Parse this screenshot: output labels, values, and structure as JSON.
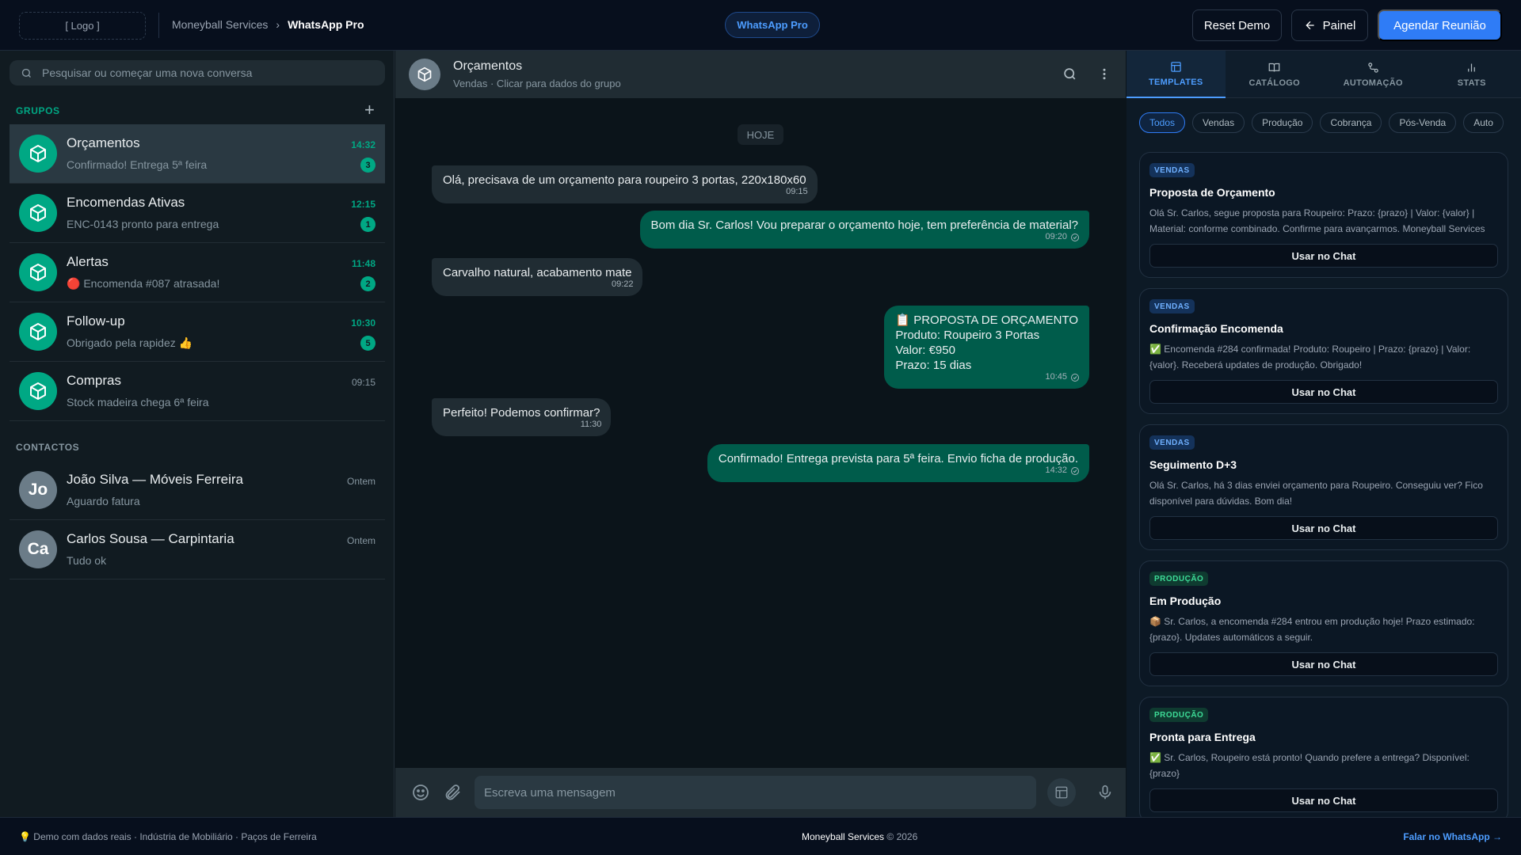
{
  "topbar": {
    "logo": "[ Logo ]",
    "breadcrumb_parent": "Moneyball Services",
    "breadcrumb_sep": "›",
    "breadcrumb_current": "WhatsApp Pro",
    "center_pill": "WhatsApp Pro",
    "reset_label": "Reset Demo",
    "panel_label": "Painel",
    "agendar_label": "Agendar Reunião"
  },
  "sidebar": {
    "search_placeholder": "Pesquisar ou começar uma nova conversa",
    "groups_header": "GRUPOS",
    "contacts_header": "CONTACTOS",
    "groups": [
      {
        "name": "Orçamentos",
        "preview": "Confirmado! Entrega 5ª feira",
        "time": "14:32",
        "badge": "3"
      },
      {
        "name": "Encomendas Ativas",
        "preview": "ENC-0143 pronto para entrega",
        "time": "12:15",
        "badge": "1"
      },
      {
        "name": "Alertas",
        "preview": "🔴 Encomenda #087 atrasada!",
        "time": "11:48",
        "badge": "2"
      },
      {
        "name": "Follow-up",
        "preview": "Obrigado pela rapidez 👍",
        "time": "10:30",
        "badge": "5"
      },
      {
        "name": "Compras",
        "preview": "Stock madeira chega 6ª feira",
        "time": "09:15",
        "badge": ""
      }
    ],
    "contacts": [
      {
        "initials": "Jo",
        "name": "João Silva — Móveis Ferreira",
        "preview": "Aguardo fatura",
        "time": "Ontem"
      },
      {
        "initials": "Ca",
        "name": "Carlos Sousa — Carpintaria",
        "preview": "Tudo ok",
        "time": "Ontem"
      }
    ]
  },
  "chat": {
    "title": "Orçamentos",
    "subtitle": "Vendas · Clicar para dados do grupo",
    "day_label": "HOJE",
    "messages": [
      {
        "dir": "in",
        "text": "Olá, precisava de um orçamento para roupeiro 3 portas, 220x180x60",
        "time": "09:15"
      },
      {
        "dir": "out",
        "text": "Bom dia Sr. Carlos! Vou preparar o orçamento hoje, tem preferência de material?",
        "time": "09:20"
      },
      {
        "dir": "in",
        "text": "Carvalho natural, acabamento mate",
        "time": "09:22"
      },
      {
        "dir": "out",
        "text": "📋 PROPOSTA DE ORÇAMENTO\nProduto: Roupeiro 3 Portas\nValor: €950\nPrazo: 15 dias",
        "time": "10:45"
      },
      {
        "dir": "in",
        "text": "Perfeito! Podemos confirmar?",
        "time": "11:30"
      },
      {
        "dir": "out",
        "text": "Confirmado! Entrega prevista para 5ª feira. Envio ficha de produção.",
        "time": "14:32"
      }
    ],
    "composer_placeholder": "Escreva uma mensagem"
  },
  "panel": {
    "tabs": [
      "TEMPLATES",
      "CATÁLOGO",
      "AUTOMAÇÃO",
      "STATS"
    ],
    "filters": [
      "Todos",
      "Vendas",
      "Produção",
      "Cobrança",
      "Pós-Venda",
      "Auto"
    ],
    "use_label": "Usar no Chat",
    "templates": [
      {
        "tag": "VENDAS",
        "title": "Proposta de Orçamento",
        "text": "Olá Sr. Carlos, segue proposta para Roupeiro: Prazo: {prazo} | Valor: {valor} | Material: conforme combinado. Confirme para avançarmos. Moneyball Services"
      },
      {
        "tag": "VENDAS",
        "title": "Confirmação Encomenda",
        "text": "✅ Encomenda #284 confirmada! Produto: Roupeiro | Prazo: {prazo} | Valor: {valor}. Receberá updates de produção. Obrigado!"
      },
      {
        "tag": "VENDAS",
        "title": "Seguimento D+3",
        "text": "Olá Sr. Carlos, há 3 dias enviei orçamento para Roupeiro. Conseguiu ver? Fico disponível para dúvidas. Bom dia!"
      },
      {
        "tag": "PRODUÇÃO",
        "title": "Em Produção",
        "text": "📦 Sr. Carlos, a encomenda #284 entrou em produção hoje! Prazo estimado: {prazo}. Updates automáticos a seguir."
      },
      {
        "tag": "PRODUÇÃO",
        "title": "Pronta para Entrega",
        "text": "✅ Sr. Carlos, Roupeiro está pronto! Quando prefere a entrega? Disponível: {prazo}"
      }
    ]
  },
  "footer": {
    "left": "💡 Demo com dados reais · Indústria de Mobiliário · Paços de Ferreira",
    "brand": "Moneyball Services",
    "copyright": "© 2026",
    "cta": "Falar no WhatsApp →"
  },
  "colors": {
    "accent_green": "#00a884",
    "accent_blue": "#2f7cf6",
    "bubble_out": "#005c4b",
    "bubble_in": "#202c33"
  }
}
